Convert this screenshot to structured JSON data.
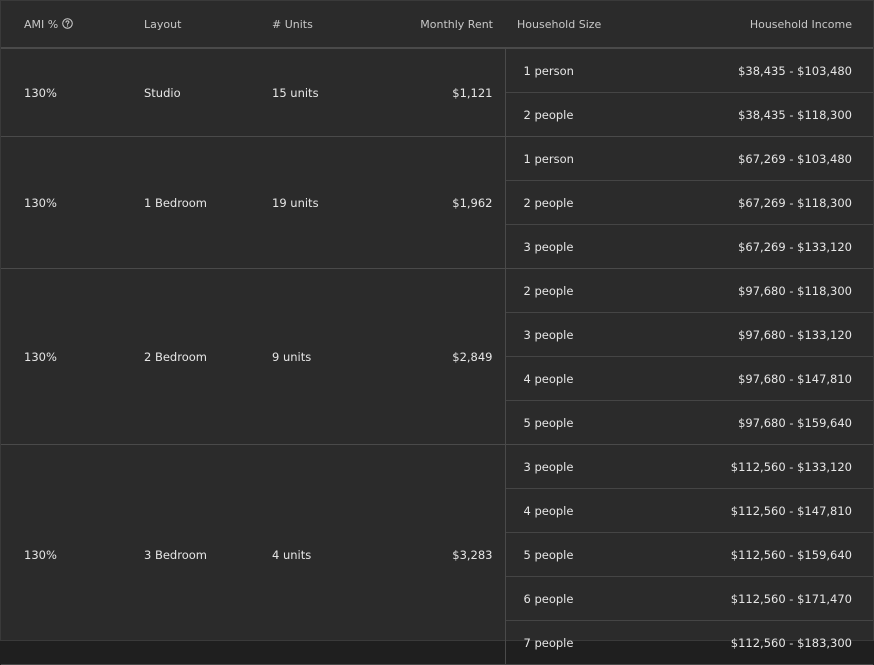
{
  "table": {
    "headers": {
      "ami": "AMI %",
      "layout": "Layout",
      "units": "# Units",
      "rent": "Monthly Rent",
      "household_size": "Household Size",
      "household_income": "Household Income"
    },
    "groups": [
      {
        "ami": "130%",
        "layout": "Studio",
        "units": "15 units",
        "rent": "$1,121",
        "rows": [
          {
            "size": "1 person",
            "income": "$38,435 - $103,480"
          },
          {
            "size": "2 people",
            "income": "$38,435 - $118,300"
          }
        ]
      },
      {
        "ami": "130%",
        "layout": "1 Bedroom",
        "units": "19 units",
        "rent": "$1,962",
        "rows": [
          {
            "size": "1 person",
            "income": "$67,269 - $103,480"
          },
          {
            "size": "2 people",
            "income": "$67,269 - $118,300"
          },
          {
            "size": "3 people",
            "income": "$67,269 - $133,120"
          }
        ]
      },
      {
        "ami": "130%",
        "layout": "2 Bedroom",
        "units": "9 units",
        "rent": "$2,849",
        "rows": [
          {
            "size": "2 people",
            "income": "$97,680 - $118,300"
          },
          {
            "size": "3 people",
            "income": "$97,680 - $133,120"
          },
          {
            "size": "4 people",
            "income": "$97,680 - $147,810"
          },
          {
            "size": "5 people",
            "income": "$97,680 - $159,640"
          }
        ]
      },
      {
        "ami": "130%",
        "layout": "3 Bedroom",
        "units": "4 units",
        "rent": "$3,283",
        "rows": [
          {
            "size": "3 people",
            "income": "$112,560 - $133,120"
          },
          {
            "size": "4 people",
            "income": "$112,560 - $147,810"
          },
          {
            "size": "5 people",
            "income": "$112,560 - $159,640"
          },
          {
            "size": "6 people",
            "income": "$112,560 - $171,470"
          },
          {
            "size": "7 people",
            "income": "$112,560 - $183,300"
          }
        ]
      }
    ]
  },
  "icons": {
    "ami_help": "question-circle-icon"
  },
  "colors": {
    "background": "#2b2b2b",
    "text": "#e6e6e6",
    "header_text": "#c8c8c8",
    "divider": "#4a4a4a"
  }
}
